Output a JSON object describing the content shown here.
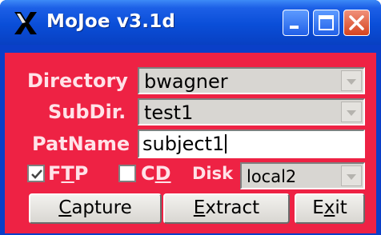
{
  "window": {
    "title": "MoJoe v3.1d",
    "app_icon": "x-logo-icon",
    "controls": [
      "minimize-icon",
      "maximize-icon",
      "close-icon"
    ]
  },
  "form": {
    "directory": {
      "label": "Directory",
      "value": "bwagner"
    },
    "subdir": {
      "label": "SubDir.",
      "value": "test1"
    },
    "patname": {
      "label": "PatName",
      "value": "subject1"
    },
    "ftp": {
      "label": "FTP",
      "mnemonic": "T",
      "checked": true
    },
    "cd": {
      "label": "CD",
      "mnemonic": "D",
      "checked": false
    },
    "disk": {
      "label": "Disk",
      "value": "local2"
    }
  },
  "buttons": {
    "capture": {
      "label": "Capture",
      "mnemonic": "C"
    },
    "extract": {
      "label": "Extract",
      "mnemonic": "E"
    },
    "exit": {
      "label": "Exit",
      "mnemonic": "x"
    }
  },
  "colors": {
    "panel": "#ee2244",
    "titlebar": "#0a4ed8",
    "label_text": "#ffe2e8"
  }
}
